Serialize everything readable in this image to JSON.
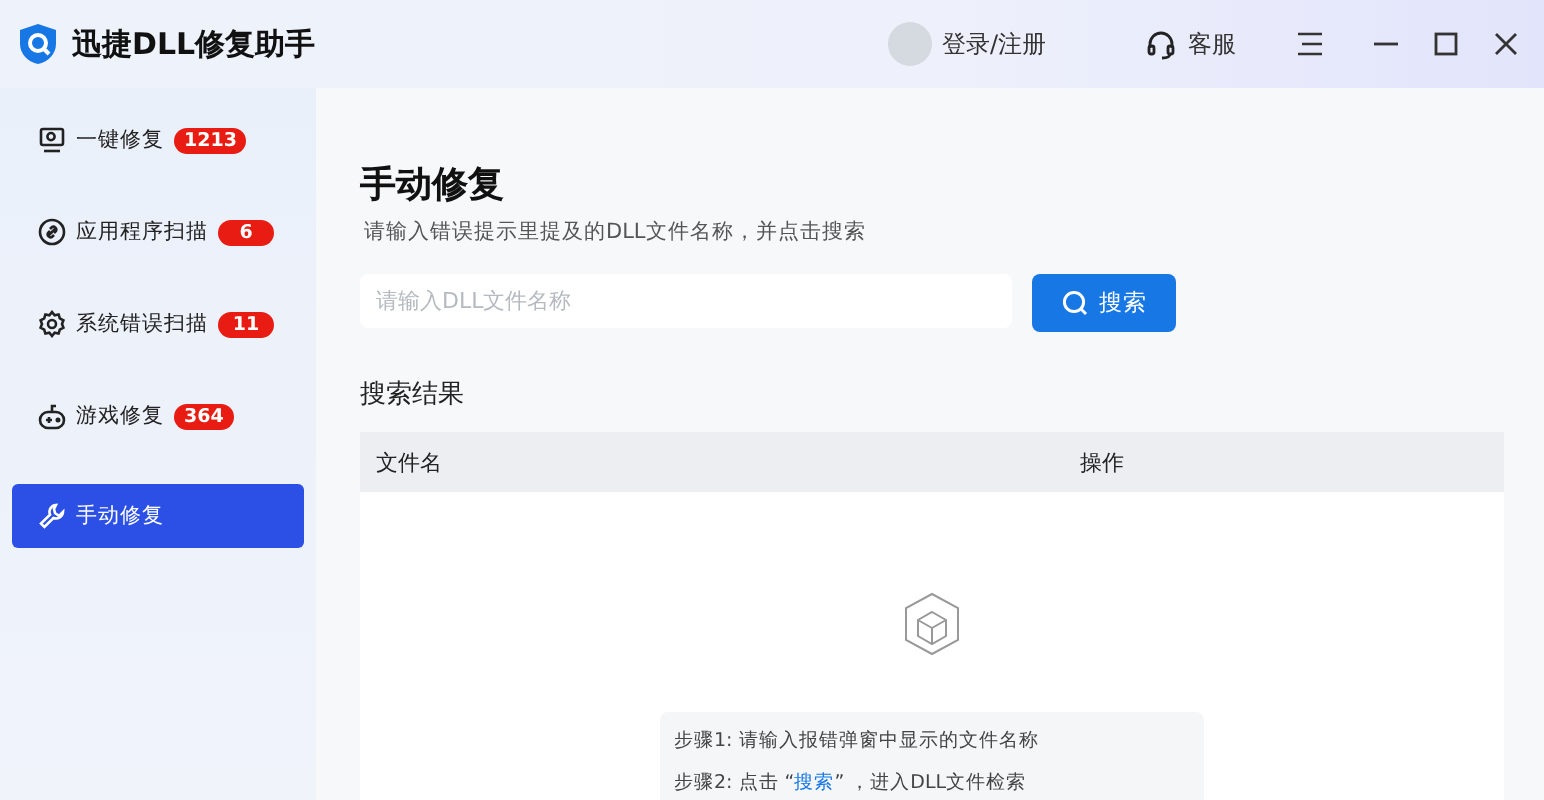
{
  "app": {
    "title": "迅捷DLL修复助手"
  },
  "header": {
    "login": "登录/注册",
    "service": "客服"
  },
  "sidebar": {
    "items": [
      {
        "label": "一键修复",
        "badge": "1213",
        "selected": false
      },
      {
        "label": "应用程序扫描",
        "badge": "6",
        "selected": false
      },
      {
        "label": "系统错误扫描",
        "badge": "11",
        "selected": false
      },
      {
        "label": "游戏修复",
        "badge": "364",
        "selected": false
      },
      {
        "label": "手动修复",
        "selected": true
      }
    ]
  },
  "main": {
    "title": "手动修复",
    "subtitle": "请输入错误提示里提及的DLL文件名称，并点击搜索",
    "search": {
      "placeholder": "请输入DLL文件名称",
      "button": "搜索"
    },
    "results_title": "搜索结果",
    "table": {
      "columns": [
        "文件名",
        "操作"
      ]
    },
    "steps": [
      [
        {
          "kind": "text",
          "text": "步骤1: 请输入报错弹窗中显示的文件名称"
        }
      ],
      [
        {
          "kind": "text",
          "text": "步骤2: 点击 “"
        },
        {
          "kind": "link",
          "text": "搜索"
        },
        {
          "kind": "text",
          "text": "” ，进入DLL文件检索"
        }
      ]
    ]
  }
}
